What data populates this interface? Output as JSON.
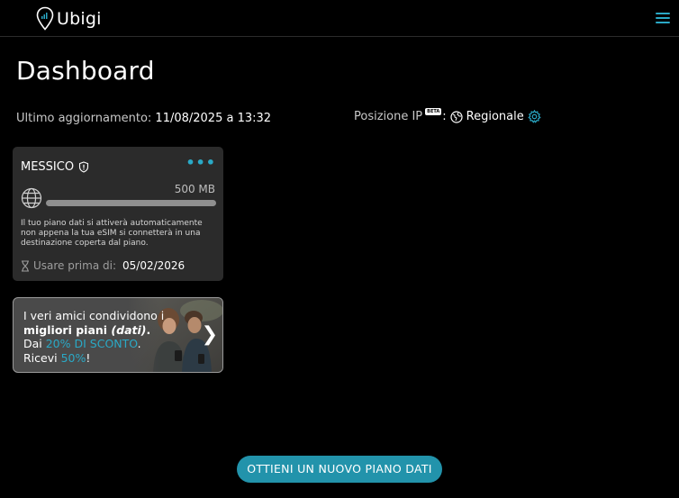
{
  "header": {
    "brand": "Ubigi",
    "menu_icon": "hamburger-icon"
  },
  "page": {
    "title": "Dashboard"
  },
  "update": {
    "label": "Ultimo aggiornamento:",
    "date": "11/08/2025",
    "sep": "a",
    "time": "13:32"
  },
  "ip_position": {
    "label": "Posizione IP",
    "badge": "BETA",
    "colon": ":",
    "value": "Regionale"
  },
  "plan": {
    "country": "MESSICO",
    "data_amount": "500 MB",
    "usage_fraction": 0,
    "note": "Il tuo piano dati si attiverà automaticamente non appena la tua eSIM si connetterà in una destinazione coperta dal piano.",
    "expiry_label": "Usare prima di:",
    "expiry_date": "05/02/2026"
  },
  "promo": {
    "line1": "I veri amici condividono i",
    "line2_a": "migliori piani ",
    "line2_b": "(dati)",
    "line2_c": ".",
    "line3_a": "Dai ",
    "line3_hl": "20% DI SCONTO",
    "line3_c": ".",
    "line4_a": "Ricevi ",
    "line4_hl": "50%",
    "line4_c": "!"
  },
  "cta": {
    "label": "OTTIENI UN NUOVO PIANO DATI"
  },
  "colors": {
    "accent": "#2aa9c6",
    "button": "#2293ab",
    "card": "#2b2b2b",
    "background": "#000000"
  }
}
